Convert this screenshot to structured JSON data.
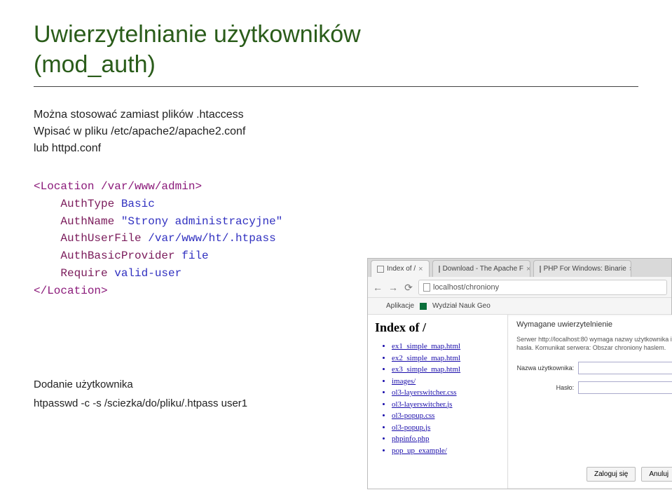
{
  "title_line1": "Uwierzytelnianie użytkowników",
  "title_line2": "(mod_auth)",
  "intro": {
    "l1": "Można stosować zamiast plików .htaccess",
    "l2": "Wpisać w pliku /etc/apache2/apache2.conf",
    "l3": "lub httpd.conf"
  },
  "code": {
    "open_tag": "<Location /var/www/admin>",
    "l1a": "AuthType ",
    "l1b": "Basic",
    "l2a": "AuthName ",
    "l2b": "\"Strony administracyjne\"",
    "l3a": "AuthUserFile ",
    "l3b": "/var/www/ht/.htpass",
    "l4a": "AuthBasicProvider ",
    "l4b": "file",
    "l5a": "Require ",
    "l5b": "valid-user",
    "close_tag": "</Location>"
  },
  "adduser": {
    "heading": "Dodanie użytkownika",
    "cmd": "htpasswd -c -s /sciezka/do/pliku/.htpass  user1"
  },
  "browser": {
    "tabs": [
      {
        "label": "Index of /"
      },
      {
        "label": "Download - The Apache F"
      },
      {
        "label": "PHP For Windows: Binarie"
      }
    ],
    "address": "localhost/chroniony",
    "bookmarks": {
      "apps": "Aplikacje",
      "wng": "Wydział Nauk Geo"
    },
    "page_heading": "Index of /",
    "listing": [
      "ex1_simple_map.html",
      "ex2_simple_map.html",
      "ex3_simple_map.html",
      "images/",
      "ol3-layerswitcher.css",
      "ol3-layerswitcher.js",
      "ol3-popup.css",
      "ol3-popup.js",
      "phpinfo.php",
      "pop_up_example/"
    ],
    "dialog": {
      "title": "Wymagane uwierzytelnienie",
      "message": "Serwer http://localhost:80 wymaga nazwy użytkownika i hasła. Komunikat serwera: Obszar chroniony haslem.",
      "user_label": "Nazwa użytkownika:",
      "pass_label": "Hasło:",
      "login_btn": "Zaloguj się",
      "cancel_btn": "Anuluj"
    }
  }
}
